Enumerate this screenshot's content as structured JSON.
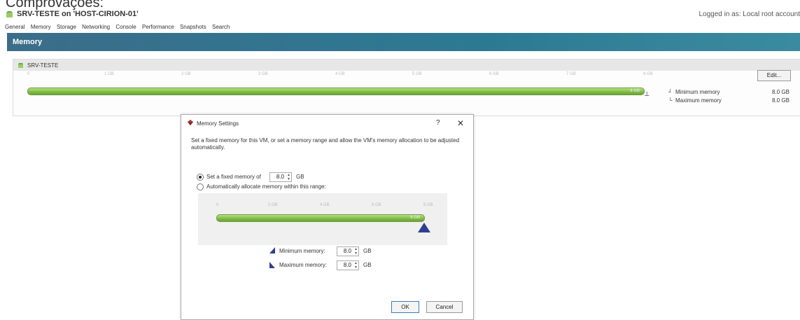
{
  "caption": "Comprovações:",
  "window": {
    "title": "SRV-TESTE on 'HOST-CIRION-01'",
    "logged_in": "Logged in as: Local root account"
  },
  "tabs": [
    "General",
    "Memory",
    "Storage",
    "Networking",
    "Console",
    "Performance",
    "Snapshots",
    "Search"
  ],
  "section_header": "Memory",
  "vm_panel": {
    "vm_name": "SRV-TESTE",
    "scale_ticks": [
      "0",
      "1 GB",
      "2 GB",
      "3 GB",
      "4 GB",
      "5 GB",
      "6 GB",
      "7 GB",
      "8 GB"
    ],
    "bar_label": "8 GB",
    "bar_fill": 1.0,
    "edit_label": "Edit...",
    "min_label": "Minimum memory",
    "min_value": "8.0 GB",
    "max_label": "Maximum memory",
    "max_value": "8.0 GB"
  },
  "dialog": {
    "title": "Memory Settings",
    "help": "?",
    "close": "✕",
    "description": "Set a fixed memory for this VM, or set a memory range and allow the VM's memory allocation to be adjusted automatically.",
    "fixed_label": "Set a fixed memory of",
    "fixed_value": "8.0",
    "unit": "GB",
    "auto_label": "Automatically allocate memory within this range:",
    "range_ticks": [
      "0",
      "2 GB",
      "4 GB",
      "6 GB",
      "8 GB"
    ],
    "range_bar_label": "8 GB",
    "min_label": "Minimum memory:",
    "min_value": "8.0",
    "max_label": "Maximum memory:",
    "max_value": "8.0",
    "ok": "OK",
    "cancel": "Cancel"
  },
  "colors": {
    "header_blue": "#2c7a92",
    "bar_green": "#7dbb43",
    "marker_blue": "#2d3f8f"
  }
}
